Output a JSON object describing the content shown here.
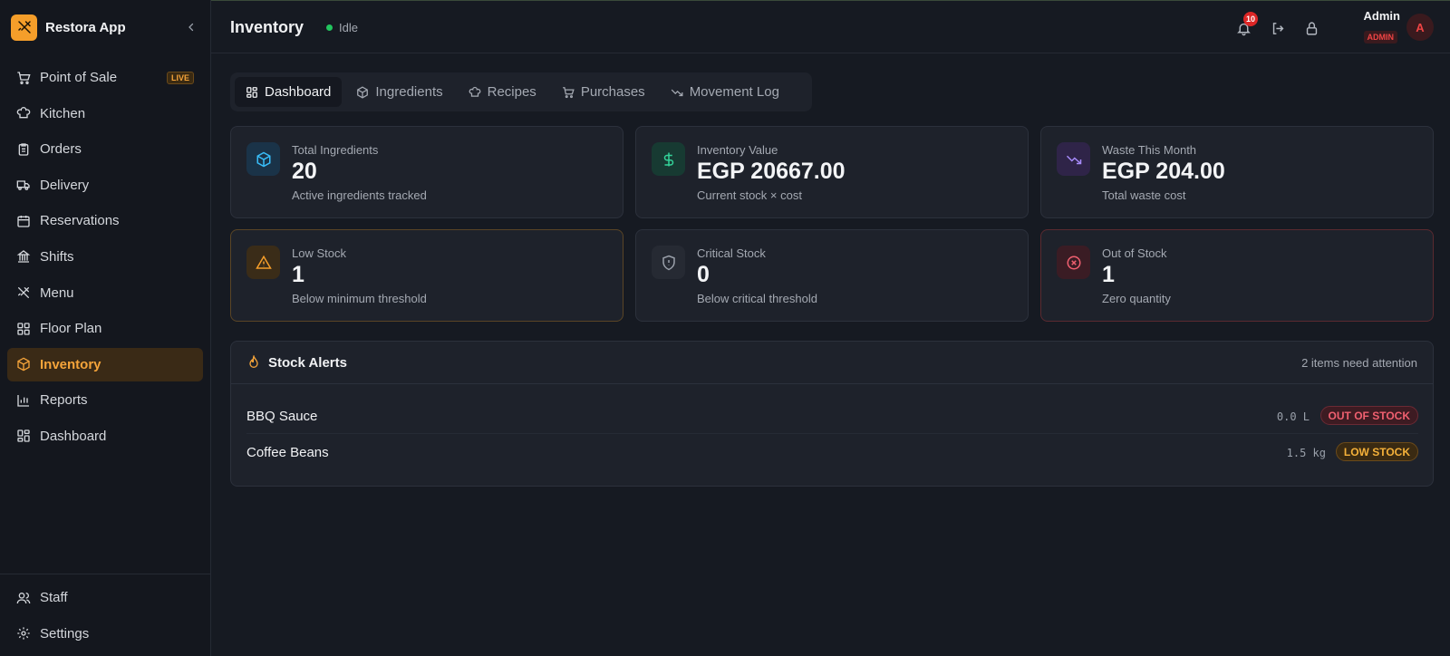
{
  "app": {
    "name": "Restora App"
  },
  "sidebar": {
    "items": [
      {
        "label": "Point of Sale",
        "icon": "cart-icon",
        "badge": "LIVE"
      },
      {
        "label": "Kitchen",
        "icon": "chef-hat-icon"
      },
      {
        "label": "Orders",
        "icon": "clipboard-icon"
      },
      {
        "label": "Delivery",
        "icon": "truck-icon"
      },
      {
        "label": "Reservations",
        "icon": "calendar-icon"
      },
      {
        "label": "Shifts",
        "icon": "building-icon"
      },
      {
        "label": "Menu",
        "icon": "utensils-icon"
      },
      {
        "label": "Floor Plan",
        "icon": "grid-icon"
      },
      {
        "label": "Inventory",
        "icon": "package-icon",
        "active": true
      },
      {
        "label": "Reports",
        "icon": "bar-chart-icon"
      },
      {
        "label": "Dashboard",
        "icon": "dashboard-icon"
      }
    ],
    "bottom": [
      {
        "label": "Staff",
        "icon": "users-icon"
      },
      {
        "label": "Settings",
        "icon": "gear-icon"
      }
    ]
  },
  "header": {
    "title": "Inventory",
    "status": "Idle",
    "notifications": "10",
    "user_name": "Admin",
    "user_role": "ADMIN",
    "avatar_initial": "A"
  },
  "tabs": [
    {
      "label": "Dashboard",
      "icon": "dashboard-icon",
      "active": true
    },
    {
      "label": "Ingredients",
      "icon": "package-icon"
    },
    {
      "label": "Recipes",
      "icon": "chef-hat-icon"
    },
    {
      "label": "Purchases",
      "icon": "cart-icon"
    },
    {
      "label": "Movement Log",
      "icon": "trending-down-icon"
    }
  ],
  "cards": [
    {
      "label": "Total Ingredients",
      "value": "20",
      "sub": "Active ingredients tracked",
      "icon": "package-icon",
      "color": "#38bdf8"
    },
    {
      "label": "Inventory Value",
      "value": "EGP 20667.00",
      "sub": "Current stock × cost",
      "icon": "dollar-icon",
      "color": "#34d399"
    },
    {
      "label": "Waste This Month",
      "value": "EGP 204.00",
      "sub": "Total waste cost",
      "icon": "trending-down-icon",
      "color": "#a78bfa"
    },
    {
      "label": "Low Stock",
      "value": "1",
      "sub": "Below minimum threshold",
      "icon": "warning-icon",
      "color": "#f59e2a"
    },
    {
      "label": "Critical Stock",
      "value": "0",
      "sub": "Below critical threshold",
      "icon": "shield-alert-icon",
      "color": "#9aa0aa"
    },
    {
      "label": "Out of Stock",
      "value": "1",
      "sub": "Zero quantity",
      "icon": "x-circle-icon",
      "color": "#f06070"
    }
  ],
  "alerts": {
    "title": "Stock Alerts",
    "count_text": "2 items need attention",
    "items": [
      {
        "name": "BBQ Sauce",
        "qty": "0.0 L",
        "status": "OUT OF STOCK"
      },
      {
        "name": "Coffee Beans",
        "qty": "1.5 kg",
        "status": "LOW STOCK"
      }
    ]
  }
}
